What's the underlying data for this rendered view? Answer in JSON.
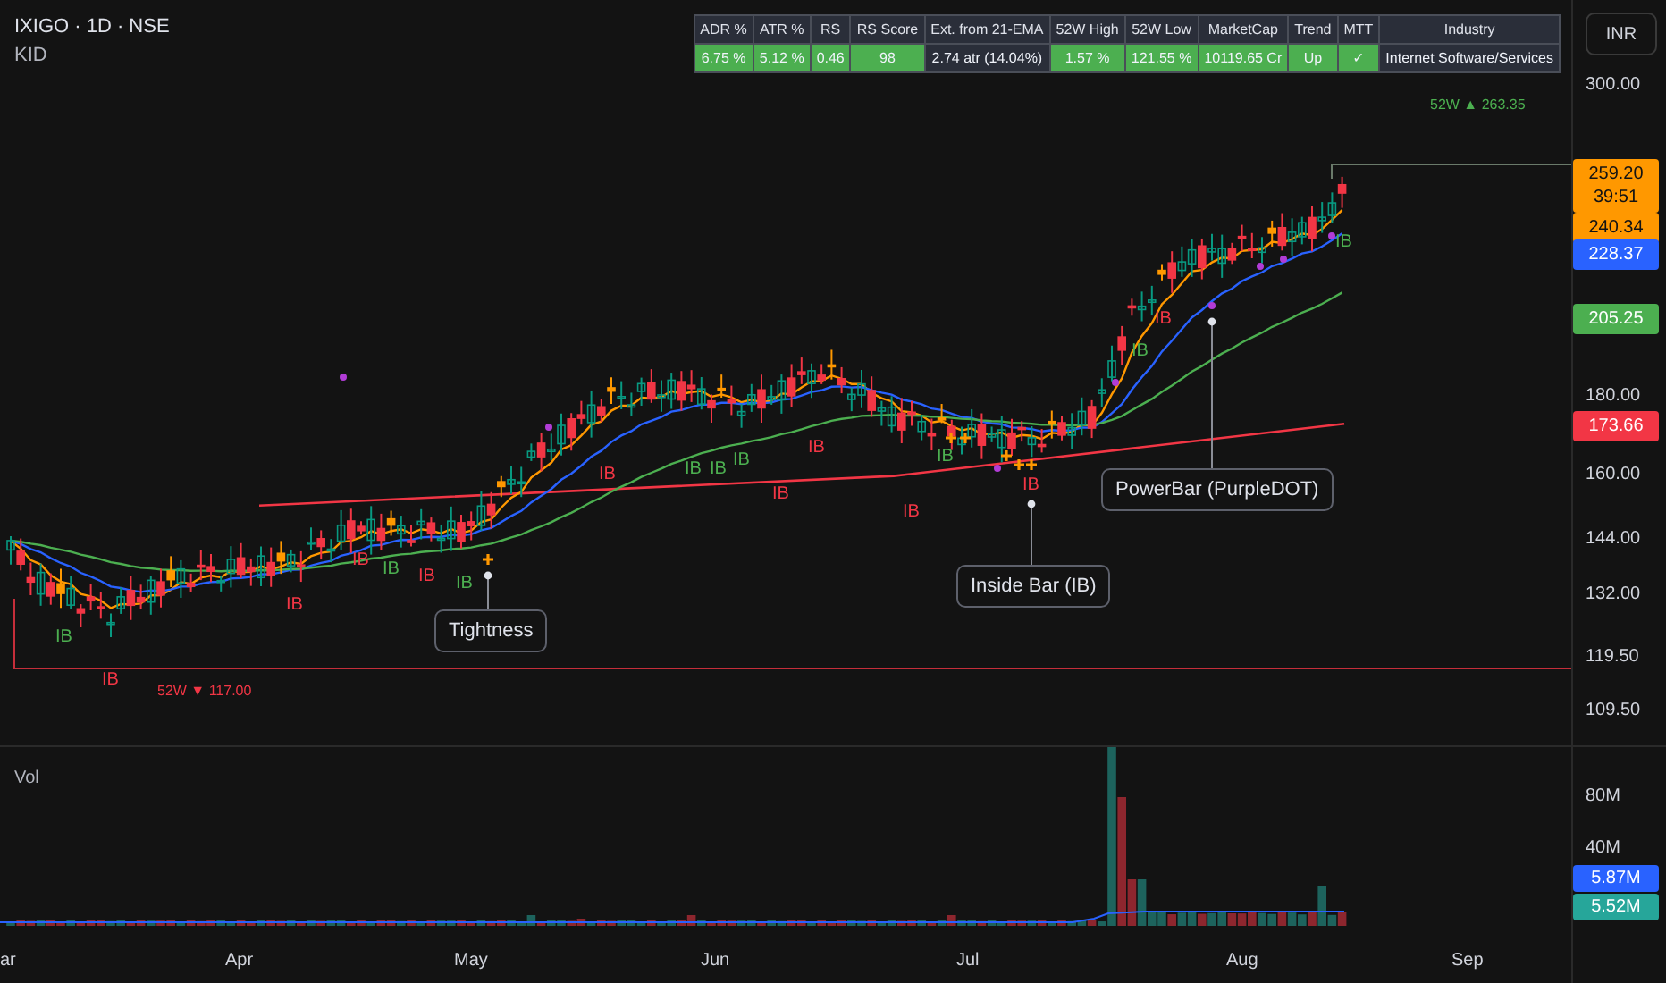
{
  "symbol": {
    "title": "IXIGO · 1D · NSE",
    "subtitle": "KID"
  },
  "currency_button": "INR",
  "stats_table": {
    "columns": [
      "ADR %",
      "ATR %",
      "RS",
      "RS Score",
      "Ext. from 21-EMA",
      "52W High",
      "52W Low",
      "MarketCap",
      "Trend",
      "MTT",
      "Industry"
    ],
    "row": [
      {
        "text": "6.75 %",
        "color": "#4caf50"
      },
      {
        "text": "5.12 %",
        "color": "#4caf50"
      },
      {
        "text": "0.46",
        "color": "#4caf50"
      },
      {
        "text": "98",
        "color": "#4caf50"
      },
      {
        "text": "2.74 atr (14.04%)",
        "color": "#2a2e39"
      },
      {
        "text": "1.57 %",
        "color": "#4caf50"
      },
      {
        "text": "121.55 %",
        "color": "#4caf50"
      },
      {
        "text": "10119.65 Cr",
        "color": "#4caf50"
      },
      {
        "text": "Up",
        "color": "#4caf50"
      },
      {
        "text": "✓",
        "color": "#4caf50"
      },
      {
        "text": "Internet Software/Services",
        "color": "#2a2e39"
      }
    ]
  },
  "level_labels": [
    {
      "text": "52W ▲ 263.35",
      "color": "#4caf50"
    },
    {
      "text": "52W ▼ 117.00",
      "color": "#f23645"
    }
  ],
  "ib_marks": [
    {
      "text": "IB",
      "color": "#4caf50"
    },
    {
      "text": "IB",
      "color": "#f23645"
    },
    {
      "text": "IB",
      "color": "#f23645"
    },
    {
      "text": "IB",
      "color": "#f23645"
    },
    {
      "text": "IB",
      "color": "#4caf50"
    },
    {
      "text": "IB",
      "color": "#f23645"
    },
    {
      "text": "IB",
      "color": "#4caf50"
    },
    {
      "text": "IB",
      "color": "#f23645"
    },
    {
      "text": "IB",
      "color": "#4caf50"
    },
    {
      "text": "IB",
      "color": "#4caf50"
    },
    {
      "text": "IB",
      "color": "#4caf50"
    },
    {
      "text": "IB",
      "color": "#f23645"
    },
    {
      "text": "IB",
      "color": "#f23645"
    },
    {
      "text": "IB",
      "color": "#f23645"
    },
    {
      "text": "IB",
      "color": "#4caf50"
    },
    {
      "text": "IB",
      "color": "#f23645"
    },
    {
      "text": "IB",
      "color": "#4caf50"
    },
    {
      "text": "IB",
      "color": "#f23645"
    },
    {
      "text": "IB",
      "color": "#4caf50"
    }
  ],
  "callouts": [
    {
      "text": "Tightness"
    },
    {
      "text": "Inside Bar (IB)"
    },
    {
      "text": "PowerBar (PurpleDOT)"
    }
  ],
  "price_axis": {
    "labels": [
      "300.00",
      "180.00",
      "160.00",
      "144.00",
      "132.00",
      "119.50",
      "109.50"
    ],
    "tags": [
      {
        "lines": [
          "259.20",
          "39:51"
        ],
        "color": "#ff9800"
      },
      {
        "lines": [
          "240.34"
        ],
        "color": "#ff9800"
      },
      {
        "lines": [
          "228.37"
        ],
        "color": "#2962ff"
      },
      {
        "lines": [
          "205.25"
        ],
        "color": "#4caf50"
      },
      {
        "lines": [
          "173.66"
        ],
        "color": "#f23645"
      }
    ]
  },
  "volume_pane": {
    "title": "Vol",
    "axis_labels": [
      "80M",
      "40M"
    ],
    "tags": [
      {
        "text": "5.87M",
        "color": "#2962ff"
      },
      {
        "text": "5.52M",
        "color": "#26a69a"
      }
    ]
  },
  "time_axis": [
    "ar",
    "Apr",
    "May",
    "Jun",
    "Jul",
    "Aug",
    "Sep"
  ]
}
